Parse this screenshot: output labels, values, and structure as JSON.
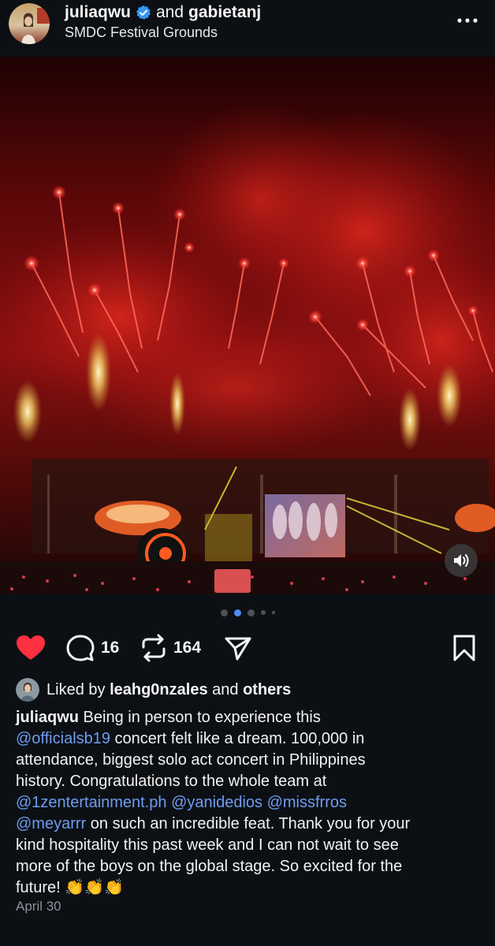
{
  "post": {
    "username": "juliaqwu",
    "and_text": "and",
    "collaborator": "gabietanj",
    "location": "SMDC Festival Grounds",
    "more_label": "•••"
  },
  "media": {
    "carousel_total": 5,
    "carousel_active": 2
  },
  "actions": {
    "comments_count": "16",
    "reposts_count": "164"
  },
  "likes": {
    "prefix": "Liked by",
    "user": "leahg0nzales",
    "mid": "and",
    "suffix": "others"
  },
  "caption": {
    "author": "juliaqwu",
    "l1_text": " Being in person to experience this",
    "l2_mention": "@officialsb19",
    "l2_text": " concert felt like a dream. 100,000 in",
    "l3_text": "attendance, biggest solo act concert in Philippines",
    "l4_text": "history. Congratulations to the whole team at",
    "l5_mention1": "@1zentertainment.ph",
    "l5_sep1": " ",
    "l5_mention2": "@yanidedios",
    "l5_sep2": " ",
    "l5_mention3": "@missfrros",
    "l6_mention": "@meyarrr",
    "l6_text": " on such an incredible feat. Thank you for your",
    "l7_text": "kind hospitality this past week and I can not wait to see",
    "l8_text": "more of the boys on the global stage. So excited for the",
    "l9_text": "future! ",
    "l9_emoji": "👏👏👏"
  },
  "date": "April 30",
  "colors": {
    "background": "#0c1014",
    "heart": "#ff3040",
    "mention": "#6f9cf0",
    "verified": "#3797f0",
    "active_dot": "#4c8df5"
  }
}
